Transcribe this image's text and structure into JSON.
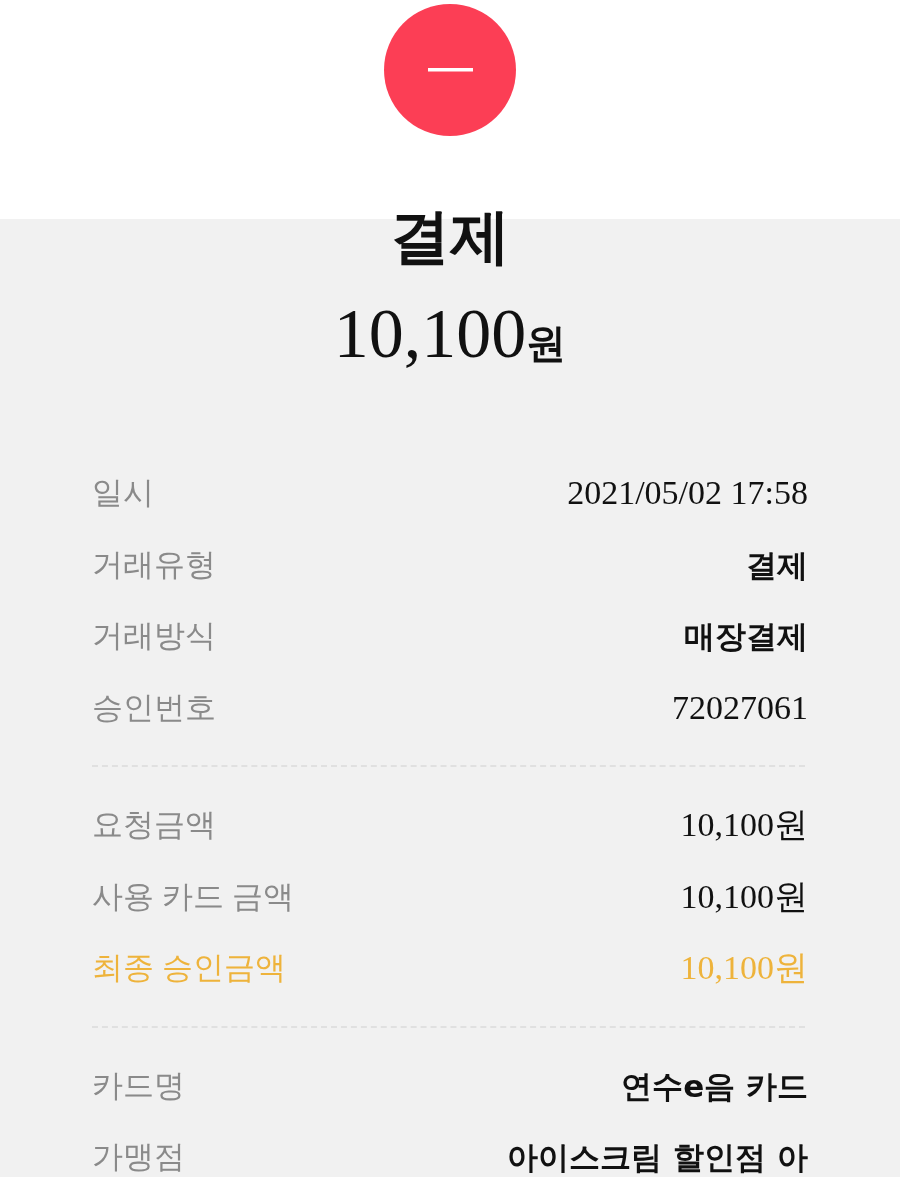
{
  "header": {
    "title": "결제",
    "total": {
      "amount": "10,100",
      "unit": "원"
    }
  },
  "details": {
    "sections": [
      {
        "rows": [
          {
            "label": "일시",
            "value": "2021/05/02 17:58",
            "bold": false,
            "highlighted": false
          },
          {
            "label": "거래유형",
            "value": "결제",
            "bold": true,
            "highlighted": false
          },
          {
            "label": "거래방식",
            "value": "매장결제",
            "bold": true,
            "highlighted": false
          },
          {
            "label": "승인번호",
            "value": "72027061",
            "bold": false,
            "highlighted": false
          }
        ]
      },
      {
        "rows": [
          {
            "label": "요청금액",
            "value": "10,100원",
            "bold": false,
            "highlighted": false
          },
          {
            "label": "사용 카드 금액",
            "value": "10,100원",
            "bold": false,
            "highlighted": false
          },
          {
            "label": "최종 승인금액",
            "value": "10,100원",
            "bold": false,
            "highlighted": true
          }
        ]
      },
      {
        "rows": [
          {
            "label": "카드명",
            "value": "연수e음 카드",
            "bold": true,
            "highlighted": false
          },
          {
            "label": "가맹점",
            "value": "아이스크림 할인점 아",
            "bold": true,
            "highlighted": false
          }
        ]
      }
    ]
  }
}
